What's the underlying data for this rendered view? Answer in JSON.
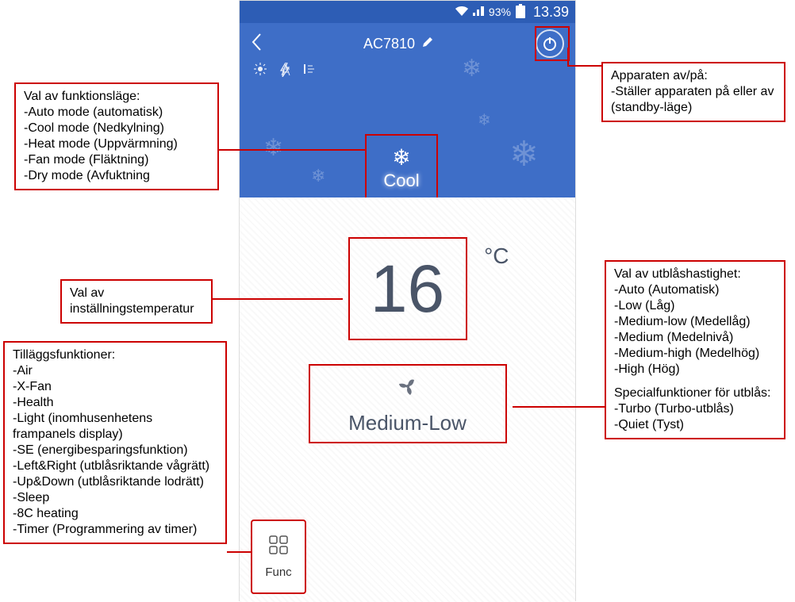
{
  "status": {
    "battery_pct": "93%",
    "time": "13.39"
  },
  "header": {
    "title": "AC7810"
  },
  "mode": {
    "label": "Cool"
  },
  "temperature": {
    "value": "16",
    "unit": "°C"
  },
  "fan": {
    "label": "Medium-Low"
  },
  "func": {
    "label": "Func"
  },
  "callouts": {
    "mode": {
      "head": "Val av funktionsläge:",
      "l1": "-Auto mode (automatisk)",
      "l2": "-Cool mode (Nedkylning)",
      "l3": "-Heat mode (Uppvärmning)",
      "l4": "-Fan mode (Fläktning)",
      "l5": "-Dry mode (Avfuktning"
    },
    "power": {
      "head": "Apparaten av/på:",
      "l1": "-Ställer apparaten på eller av (standby-läge)"
    },
    "temp": {
      "text": "Val av inställningstemperatur"
    },
    "fan": {
      "head": "Val av utblåshastighet:",
      "l1": "-Auto (Automatisk)",
      "l2": "-Low (Låg)",
      "l3": "-Medium-low (Medellåg)",
      "l4": "-Medium (Medelnivå)",
      "l5": "-Medium-high (Medelhög)",
      "l6": "-High (Hög)",
      "head2": "Specialfunktioner för utblås:",
      "l7": "-Turbo (Turbo-utblås)",
      "l8": "-Quiet (Tyst)"
    },
    "extra": {
      "head": "Tilläggsfunktioner:",
      "l1": "-Air",
      "l2": "-X-Fan",
      "l3": "-Health",
      "l4": "-Light (inomhusenhetens frampanels display)",
      "l5": "-SE (energibesparingsfunktion)",
      "l6": "-Left&Right (utblåsriktande vågrätt)",
      "l7": "-Up&Down (utblåsriktande lodrätt)",
      "l8": "-Sleep",
      "l9": "-8C heating",
      "l10": "-Timer (Programmering av timer)"
    }
  }
}
